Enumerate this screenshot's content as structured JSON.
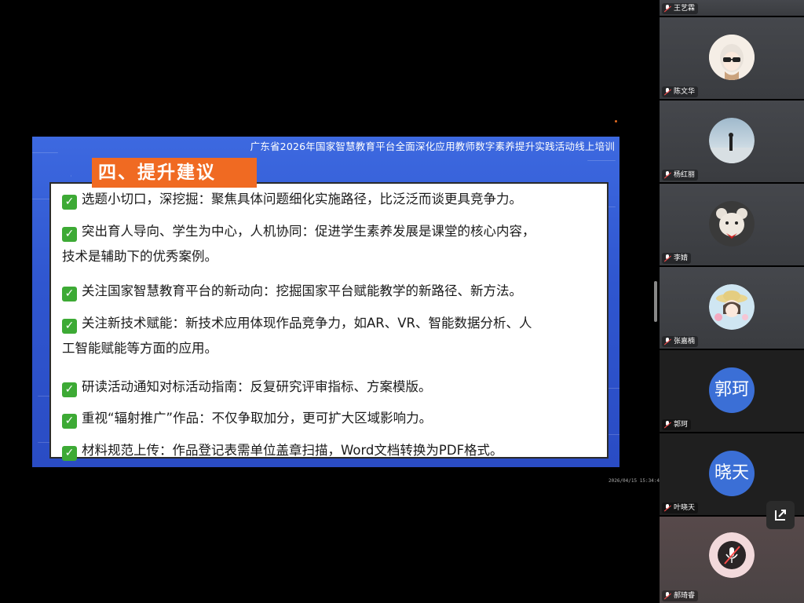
{
  "slide": {
    "banner": "广东省2026年国家智慧教育平台全面深化应用教师数字素养提升实践活动线上培训",
    "section_title": "四、提升建议",
    "items": [
      {
        "text": "选题小切口，深挖掘：聚焦具体问题细化实施路径，比泛泛而谈更具竞争力。"
      },
      {
        "text": "突出育人导向、学生为中心，人机协同：促进学生素养发展是课堂的核心内容，",
        "cont": "技术是辅助下的优秀案例。"
      },
      {
        "text": "关注国家智慧教育平台的新动向：挖掘国家平台赋能教学的新路径、新方法。"
      },
      {
        "text": "关注新技术赋能：新技术应用体现作品竞争力，如AR、VR、智能数据分析、人",
        "cont": "工智能赋能等方面的应用。"
      },
      {
        "text": "研读活动通知对标活动指南：反复研究评审指标、方案模版。"
      },
      {
        "text": "重视“辐射推广”作品：不仅争取加分，更可扩大区域影响力。"
      },
      {
        "text": "材料规范上传：作品登记表需单位盖章扫描，Word文档转换为PDF格式。"
      }
    ],
    "check_glyph": "✓"
  },
  "timestamp": "2026/04/15 15:34:48",
  "participants": [
    {
      "name": "王艺霖",
      "avatar": "none"
    },
    {
      "name": "陈文华",
      "avatar": "anime-girl-sunglasses"
    },
    {
      "name": "杨红丽",
      "avatar": "silhouette-landscape"
    },
    {
      "name": "李婧",
      "avatar": "cartoon-bear-red-bow"
    },
    {
      "name": "张嘉楠",
      "avatar": "cartoon-girl-hat"
    },
    {
      "name": "郭珂",
      "avatar_text": "郭珂"
    },
    {
      "name": "叶晓天",
      "avatar_text": "晓天"
    },
    {
      "name": "郝琦睿",
      "avatar": "muted-mic"
    }
  ],
  "colors": {
    "accent_orange": "#f06a22",
    "slide_blue": "#3d69e0",
    "check_green": "#3daa35",
    "text_avatar_blue": "#3b6fd6"
  }
}
